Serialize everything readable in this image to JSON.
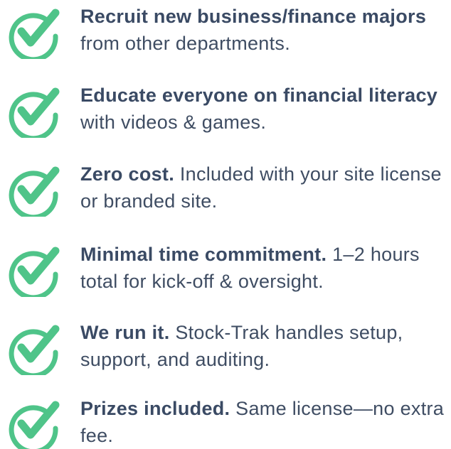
{
  "accent_color": "#4fc489",
  "text_color": "#3f4d63",
  "icon": "check-circle-icon",
  "items": [
    {
      "bold": "Recruit new business/finance majors",
      "rest": " from other departments."
    },
    {
      "bold": "Educate everyone on financial literacy",
      "rest": " with videos & games."
    },
    {
      "bold": "Zero cost.",
      "rest": " Included with your site license or branded site."
    },
    {
      "bold": "Minimal time commitment.",
      "rest": " 1–2 hours total for kick-off & oversight."
    },
    {
      "bold": "We run it.",
      "rest": " Stock-Trak handles setup, support, and auditing."
    },
    {
      "bold": "Prizes included.",
      "rest": " Same license—no extra fee."
    }
  ]
}
